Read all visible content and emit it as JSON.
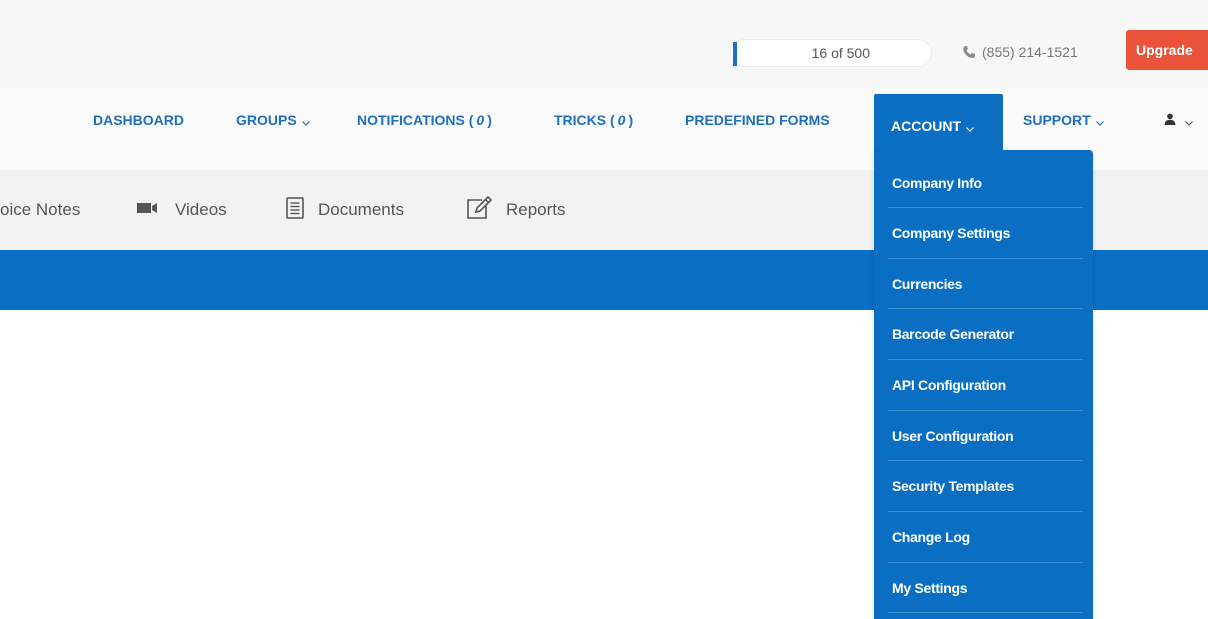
{
  "topbar": {
    "usage": {
      "text": "16 of 500",
      "used": 16,
      "total": 500
    },
    "phone": "(855) 214-1521",
    "upgrade_label": "Upgrade"
  },
  "nav": {
    "dashboard": "DASHBOARD",
    "groups": "GROUPS",
    "notifications": "NOTIFICATIONS (",
    "notifications_count": "0",
    "tricks": "TRICKS (",
    "tricks_count": "0",
    "close_paren": ")",
    "predefined_forms": "PREDEFINED FORMS",
    "account": "ACCOUNT",
    "support": "SUPPORT"
  },
  "account_menu": [
    "Company Info",
    "Company Settings",
    "Currencies",
    "Barcode Generator",
    "API Configuration",
    "User Configuration",
    "Security Templates",
    "Change Log",
    "My Settings"
  ],
  "subnav": {
    "voice_notes": "oice Notes",
    "videos": "Videos",
    "documents": "Documents",
    "reports": "Reports"
  },
  "colors": {
    "primary_blue": "#0a6fc2",
    "nav_text": "#1f6fba",
    "upgrade": "#e8533a"
  },
  "icons": [
    "phone-icon",
    "chevron-down-icon",
    "user-icon",
    "video-camera-icon",
    "document-icon",
    "edit-icon"
  ]
}
